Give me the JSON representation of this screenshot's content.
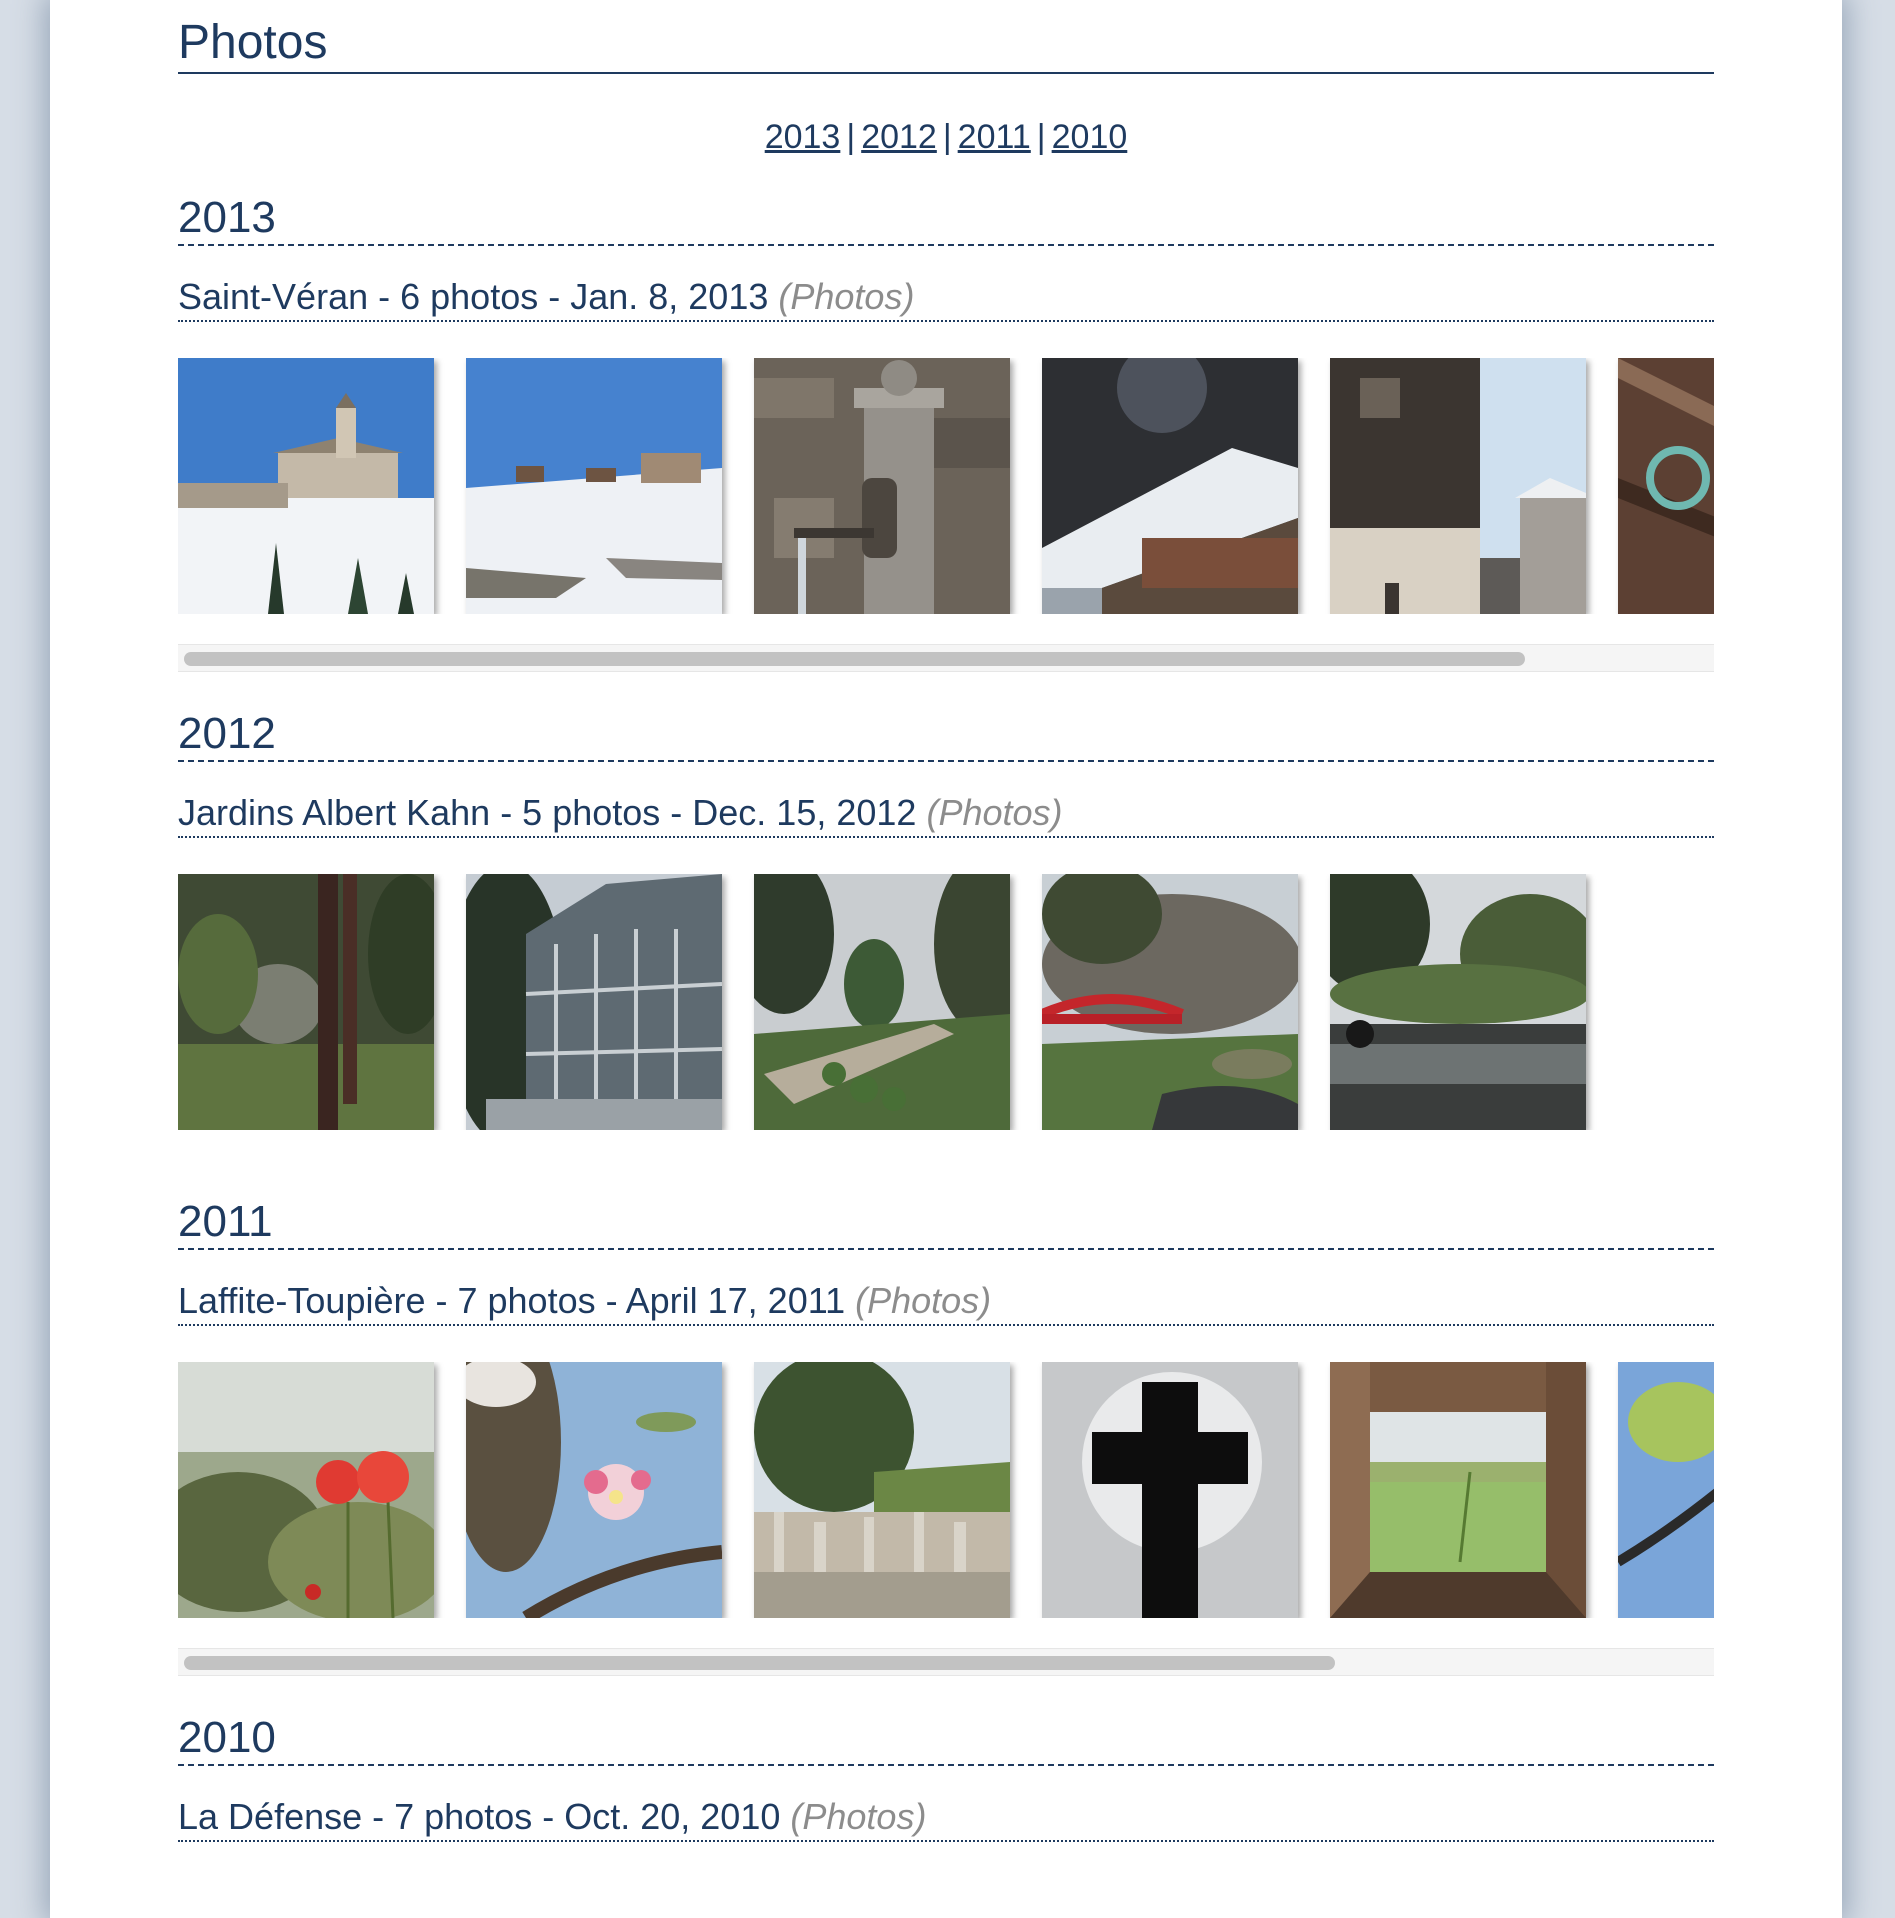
{
  "page": {
    "title": "Photos"
  },
  "year_nav": [
    "2013",
    "2012",
    "2011",
    "2010"
  ],
  "photos_tag": "(Photos)",
  "sections": [
    {
      "year": "2013",
      "album": "Saint-Véran - 6 photos - Jan. 8, 2013",
      "photo_count": 6,
      "scroll_fraction": 0.88
    },
    {
      "year": "2012",
      "album": "Jardins Albert Kahn - 5 photos - Dec. 15, 2012",
      "photo_count": 5
    },
    {
      "year": "2011",
      "album": "Laffite-Toupière - 7 photos - April 17, 2011",
      "photo_count": 7,
      "scroll_fraction": 0.755
    },
    {
      "year": "2010",
      "album": "La Défense - 7 photos - Oct. 20, 2010"
    }
  ]
}
